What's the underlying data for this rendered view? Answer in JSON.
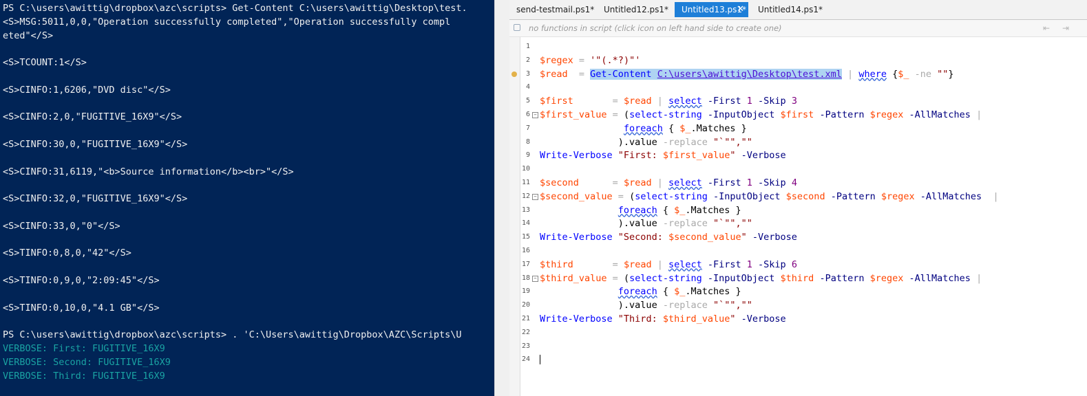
{
  "console": {
    "lines": [
      {
        "text": "PS C:\\users\\awittig\\dropbox\\azc\\scripts> Get-Content C:\\users\\awittig\\Desktop\\test.",
        "kind": "normal"
      },
      {
        "text": "<S>MSG:5011,0,0,\"Operation successfully completed\",\"Operation successfully compl",
        "kind": "normal"
      },
      {
        "text": "eted\"</S>",
        "kind": "normal"
      },
      {
        "text": "",
        "kind": "normal"
      },
      {
        "text": "<S>TCOUNT:1</S>",
        "kind": "normal"
      },
      {
        "text": "",
        "kind": "normal"
      },
      {
        "text": "<S>CINFO:1,6206,\"DVD disc\"</S>",
        "kind": "normal"
      },
      {
        "text": "",
        "kind": "normal"
      },
      {
        "text": "<S>CINFO:2,0,\"FUGITIVE_16X9\"</S>",
        "kind": "normal"
      },
      {
        "text": "",
        "kind": "normal"
      },
      {
        "text": "<S>CINFO:30,0,\"FUGITIVE_16X9\"</S>",
        "kind": "normal"
      },
      {
        "text": "",
        "kind": "normal"
      },
      {
        "text": "<S>CINFO:31,6119,\"<b>Source information</b><br>\"</S>",
        "kind": "normal"
      },
      {
        "text": "",
        "kind": "normal"
      },
      {
        "text": "<S>CINFO:32,0,\"FUGITIVE_16X9\"</S>",
        "kind": "normal"
      },
      {
        "text": "",
        "kind": "normal"
      },
      {
        "text": "<S>CINFO:33,0,\"0\"</S>",
        "kind": "normal"
      },
      {
        "text": "",
        "kind": "normal"
      },
      {
        "text": "<S>TINFO:0,8,0,\"42\"</S>",
        "kind": "normal"
      },
      {
        "text": "",
        "kind": "normal"
      },
      {
        "text": "<S>TINFO:0,9,0,\"2:09:45\"</S>",
        "kind": "normal"
      },
      {
        "text": "",
        "kind": "normal"
      },
      {
        "text": "<S>TINFO:0,10,0,\"4.1 GB\"</S>",
        "kind": "normal"
      },
      {
        "text": "",
        "kind": "normal"
      },
      {
        "text": "PS C:\\users\\awittig\\dropbox\\azc\\scripts> . 'C:\\Users\\awittig\\Dropbox\\AZC\\Scripts\\U",
        "kind": "normal"
      },
      {
        "text": "VERBOSE: First: FUGITIVE_16X9",
        "kind": "verbose"
      },
      {
        "text": "VERBOSE: Second: FUGITIVE_16X9",
        "kind": "verbose"
      },
      {
        "text": "VERBOSE: Third: FUGITIVE_16X9",
        "kind": "verbose"
      }
    ]
  },
  "tabs": [
    {
      "label": "send-testmail.ps1*",
      "active": false
    },
    {
      "label": "Untitled12.ps1*",
      "active": false
    },
    {
      "label": "Untitled13.ps1*",
      "active": true,
      "close": "✕"
    },
    {
      "label": "Untitled14.ps1*",
      "active": false
    }
  ],
  "function_bar": {
    "hint": "no functions in script (click icon on left hand side to create one)"
  },
  "editor": {
    "colors": {
      "variable": "#ff4500",
      "command": "#0000ff",
      "string": "#8b0000",
      "selection": "#aed3f2"
    },
    "lines": [
      {
        "n": "1",
        "tokens": []
      },
      {
        "n": "2",
        "tokens": [
          [
            "var",
            "$regex"
          ],
          [
            "op",
            " = "
          ],
          [
            "str",
            "'\"(.*?)\"'"
          ]
        ]
      },
      {
        "n": "3",
        "marker": true,
        "tokens": [
          [
            "var",
            "$read"
          ],
          [
            "op",
            "  = "
          ],
          [
            "cmd-sel",
            "Get-Content"
          ],
          [
            "sel",
            " "
          ],
          [
            "lnk-sel",
            "C:\\users\\awittig\\Desktop\\test.xml"
          ],
          [
            "op",
            " | "
          ],
          [
            "cmd-wavy",
            "where"
          ],
          [
            "txt",
            " {"
          ],
          [
            "var",
            "$_"
          ],
          [
            "op",
            " -ne "
          ],
          [
            "str",
            "\"\""
          ],
          [
            "txt",
            "}"
          ]
        ]
      },
      {
        "n": "4",
        "tokens": []
      },
      {
        "n": "5",
        "tokens": [
          [
            "var",
            "$first"
          ],
          [
            "op",
            "       = "
          ],
          [
            "var",
            "$read"
          ],
          [
            "op",
            " | "
          ],
          [
            "cmd-wavy",
            "select"
          ],
          [
            "param",
            " -First "
          ],
          [
            "num",
            "1"
          ],
          [
            "param",
            " -Skip "
          ],
          [
            "num",
            "3"
          ]
        ]
      },
      {
        "n": "6",
        "fold": "−",
        "tokens": [
          [
            "var",
            "$first_value"
          ],
          [
            "op",
            " = "
          ],
          [
            "txt",
            "("
          ],
          [
            "cmd",
            "select-string"
          ],
          [
            "param",
            " -InputObject "
          ],
          [
            "var",
            "$first"
          ],
          [
            "param",
            " -Pattern "
          ],
          [
            "var",
            "$regex"
          ],
          [
            "param",
            " -AllMatches"
          ],
          [
            "op",
            " |"
          ]
        ]
      },
      {
        "n": "7",
        "tokens": [
          [
            "op",
            "               "
          ],
          [
            "cmd-wavy",
            "foreach"
          ],
          [
            "txt",
            " { "
          ],
          [
            "var",
            "$_"
          ],
          [
            "txt",
            ".Matches }"
          ]
        ]
      },
      {
        "n": "8",
        "tokens": [
          [
            "op",
            "              "
          ],
          [
            "txt",
            ").value"
          ],
          [
            "op",
            " -replace "
          ],
          [
            "str",
            "\"`\"\",\"\""
          ]
        ]
      },
      {
        "n": "9",
        "tokens": [
          [
            "cmd",
            "Write-Verbose"
          ],
          [
            "str",
            " \"First: "
          ],
          [
            "var",
            "$first_value"
          ],
          [
            "str",
            "\""
          ],
          [
            "param",
            " -Verbose"
          ]
        ]
      },
      {
        "n": "10",
        "tokens": []
      },
      {
        "n": "11",
        "tokens": [
          [
            "var",
            "$second"
          ],
          [
            "op",
            "      = "
          ],
          [
            "var",
            "$read"
          ],
          [
            "op",
            " | "
          ],
          [
            "cmd-wavy",
            "select"
          ],
          [
            "param",
            " -First "
          ],
          [
            "num",
            "1"
          ],
          [
            "param",
            " -Skip "
          ],
          [
            "num",
            "4"
          ]
        ]
      },
      {
        "n": "12",
        "fold": "−",
        "tokens": [
          [
            "var",
            "$second_value"
          ],
          [
            "op",
            " = "
          ],
          [
            "txt",
            "("
          ],
          [
            "cmd",
            "select-string"
          ],
          [
            "param",
            " -InputObject "
          ],
          [
            "var",
            "$second"
          ],
          [
            "param",
            " -Pattern "
          ],
          [
            "var",
            "$regex"
          ],
          [
            "param",
            " -AllMatches"
          ],
          [
            "op",
            "  |"
          ]
        ]
      },
      {
        "n": "13",
        "tokens": [
          [
            "op",
            "              "
          ],
          [
            "cmd-wavy",
            "foreach"
          ],
          [
            "txt",
            " { "
          ],
          [
            "var",
            "$_"
          ],
          [
            "txt",
            ".Matches }"
          ]
        ]
      },
      {
        "n": "14",
        "tokens": [
          [
            "op",
            "              "
          ],
          [
            "txt",
            ").value"
          ],
          [
            "op",
            " -replace "
          ],
          [
            "str",
            "\"`\"\",\"\""
          ]
        ]
      },
      {
        "n": "15",
        "tokens": [
          [
            "cmd",
            "Write-Verbose"
          ],
          [
            "str",
            " \"Second: "
          ],
          [
            "var",
            "$second_value"
          ],
          [
            "str",
            "\""
          ],
          [
            "param",
            " -Verbose"
          ]
        ]
      },
      {
        "n": "16",
        "tokens": []
      },
      {
        "n": "17",
        "tokens": [
          [
            "var",
            "$third"
          ],
          [
            "op",
            "       = "
          ],
          [
            "var",
            "$read"
          ],
          [
            "op",
            " | "
          ],
          [
            "cmd-wavy",
            "select"
          ],
          [
            "param",
            " -First "
          ],
          [
            "num",
            "1"
          ],
          [
            "param",
            " -Skip "
          ],
          [
            "num",
            "6"
          ]
        ]
      },
      {
        "n": "18",
        "fold": "−",
        "tokens": [
          [
            "var",
            "$third_value"
          ],
          [
            "op",
            " = "
          ],
          [
            "txt",
            "("
          ],
          [
            "cmd",
            "select-string"
          ],
          [
            "param",
            " -InputObject "
          ],
          [
            "var",
            "$third"
          ],
          [
            "param",
            " -Pattern "
          ],
          [
            "var",
            "$regex"
          ],
          [
            "param",
            " -AllMatches"
          ],
          [
            "op",
            " |"
          ]
        ]
      },
      {
        "n": "19",
        "tokens": [
          [
            "op",
            "              "
          ],
          [
            "cmd-wavy",
            "foreach"
          ],
          [
            "txt",
            " { "
          ],
          [
            "var",
            "$_"
          ],
          [
            "txt",
            ".Matches }"
          ]
        ]
      },
      {
        "n": "20",
        "tokens": [
          [
            "op",
            "              "
          ],
          [
            "txt",
            ").value"
          ],
          [
            "op",
            " -replace "
          ],
          [
            "str",
            "\"`\"\",\"\""
          ]
        ]
      },
      {
        "n": "21",
        "tokens": [
          [
            "cmd",
            "Write-Verbose"
          ],
          [
            "str",
            " \"Third: "
          ],
          [
            "var",
            "$third_value"
          ],
          [
            "str",
            "\""
          ],
          [
            "param",
            " -Verbose"
          ]
        ]
      },
      {
        "n": "22",
        "tokens": []
      },
      {
        "n": "23",
        "tokens": []
      },
      {
        "n": "24",
        "cursor": true,
        "tokens": []
      }
    ]
  }
}
